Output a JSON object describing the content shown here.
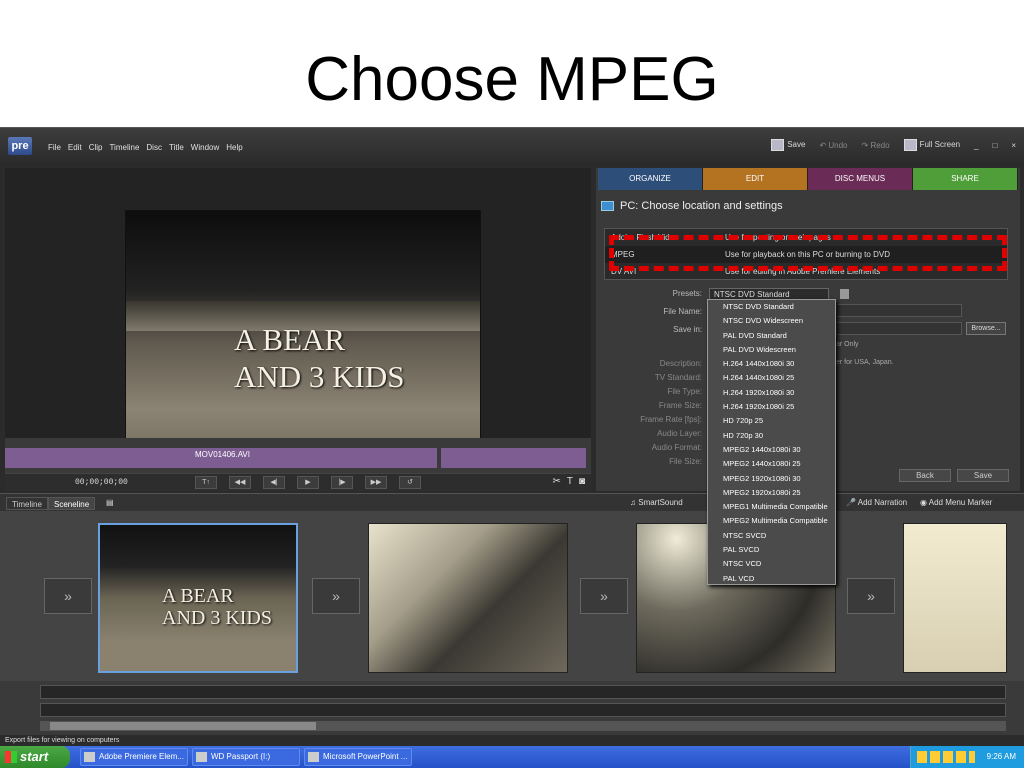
{
  "slide": {
    "title": "Choose MPEG"
  },
  "app": {
    "logo": "pre",
    "menus": [
      "File",
      "Edit",
      "Clip",
      "Timeline",
      "Disc",
      "Title",
      "Window",
      "Help"
    ],
    "toolbar": {
      "save": "Save",
      "undo": "Undo",
      "redo": "Redo",
      "fullscreen": "Full Screen",
      "min": "_",
      "max": "□",
      "close": "×"
    }
  },
  "monitor": {
    "video_title_line1": "A BEAR",
    "video_title_line2": "AND 3 KIDS",
    "clip_name": "MOV01406.AVI",
    "timecode": "00;00;00;00",
    "transport": [
      "T↑",
      "◀◀",
      "◀|",
      "▶",
      "|▶",
      "▶▶",
      "↺"
    ]
  },
  "tabs": [
    "ORGANIZE",
    "EDIT",
    "DISC MENUS",
    "SHARE"
  ],
  "share": {
    "heading": "PC: Choose location and settings",
    "formats": [
      {
        "name": "Adobe Flash Video",
        "desc": "Use for posting on web pages"
      },
      {
        "name": "MPEG",
        "desc": "Use for playback on this PC or burning to DVD"
      },
      {
        "name": "DV AVI",
        "desc": "Use for editing in Adobe Premiere Elements"
      }
    ],
    "labels": {
      "presets": "Presets:",
      "file_name": "File Name:",
      "save_in": "Save in:",
      "description": "Description:",
      "tv_standard": "TV Standard:",
      "file_type": "File Type:",
      "frame_size": "Frame Size:",
      "frame_rate": "Frame Rate [fps]:",
      "audio_layer": "Audio Layer:",
      "audio_format": "Audio Format:",
      "file_size": "File Size:"
    },
    "preset_value": "NTSC DVD Standard",
    "browse": "Browse...",
    "checkbox_fragment": "ar Only",
    "desc_fragment": "er for USA, Japan.",
    "back": "Back",
    "save": "Save"
  },
  "presets": [
    "NTSC DVD Standard",
    "NTSC DVD Widescreen",
    "PAL DVD Standard",
    "PAL DVD Widescreen",
    "H.264 1440x1080i 30",
    "H.264 1440x1080i 25",
    "H.264 1920x1080i 30",
    "H.264 1920x1080i 25",
    "HD 720p 25",
    "HD 720p 30",
    "MPEG2 1440x1080i 30",
    "MPEG2 1440x1080i 25",
    "MPEG2 1920x1080i 30",
    "MPEG2 1920x1080i 25",
    "MPEG1 Multimedia Compatible",
    "MPEG2 Multimedia Compatible",
    "NTSC SVCD",
    "PAL SVCD",
    "NTSC VCD",
    "PAL VCD"
  ],
  "bottom": {
    "timeline_tab": "Timeline",
    "sceneline_tab": "Sceneline",
    "smartsound": "SmartSound",
    "add_narration": "Add Narration",
    "add_menu_marker": "Add Menu Marker"
  },
  "scenes": {
    "thumb_title_line1": "A BEAR",
    "thumb_title_line2": "AND 3 KIDS"
  },
  "status": "Export files for viewing on computers",
  "taskbar": {
    "start": "start",
    "apps": [
      "Adobe Premiere Elem...",
      "WD Passport (I:)",
      "Microsoft PowerPoint ..."
    ],
    "clock": "9:26 AM"
  }
}
